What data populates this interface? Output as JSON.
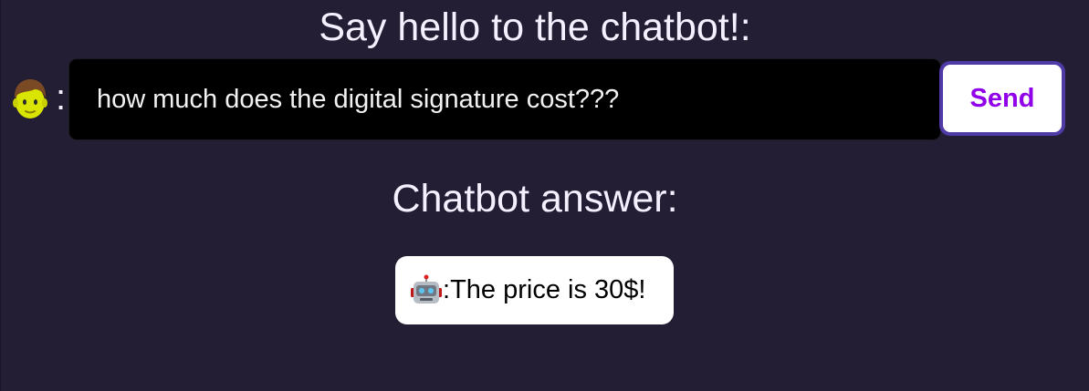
{
  "prompt": {
    "title": "Say hello to the chatbot!:",
    "user_icon": "man-face-icon",
    "separator": ":",
    "input_value": "how much does the digital signature cost???",
    "send_label": "Send"
  },
  "answer": {
    "title": "Chatbot answer:",
    "bot_icon": "robot-face-icon",
    "separator": ":",
    "text": " The price is 30$!"
  },
  "colors": {
    "background": "#241e34",
    "input_background": "#000000",
    "send_text": "#9000e8",
    "send_border": "#4f3aa6",
    "answer_background": "#ffffff"
  }
}
